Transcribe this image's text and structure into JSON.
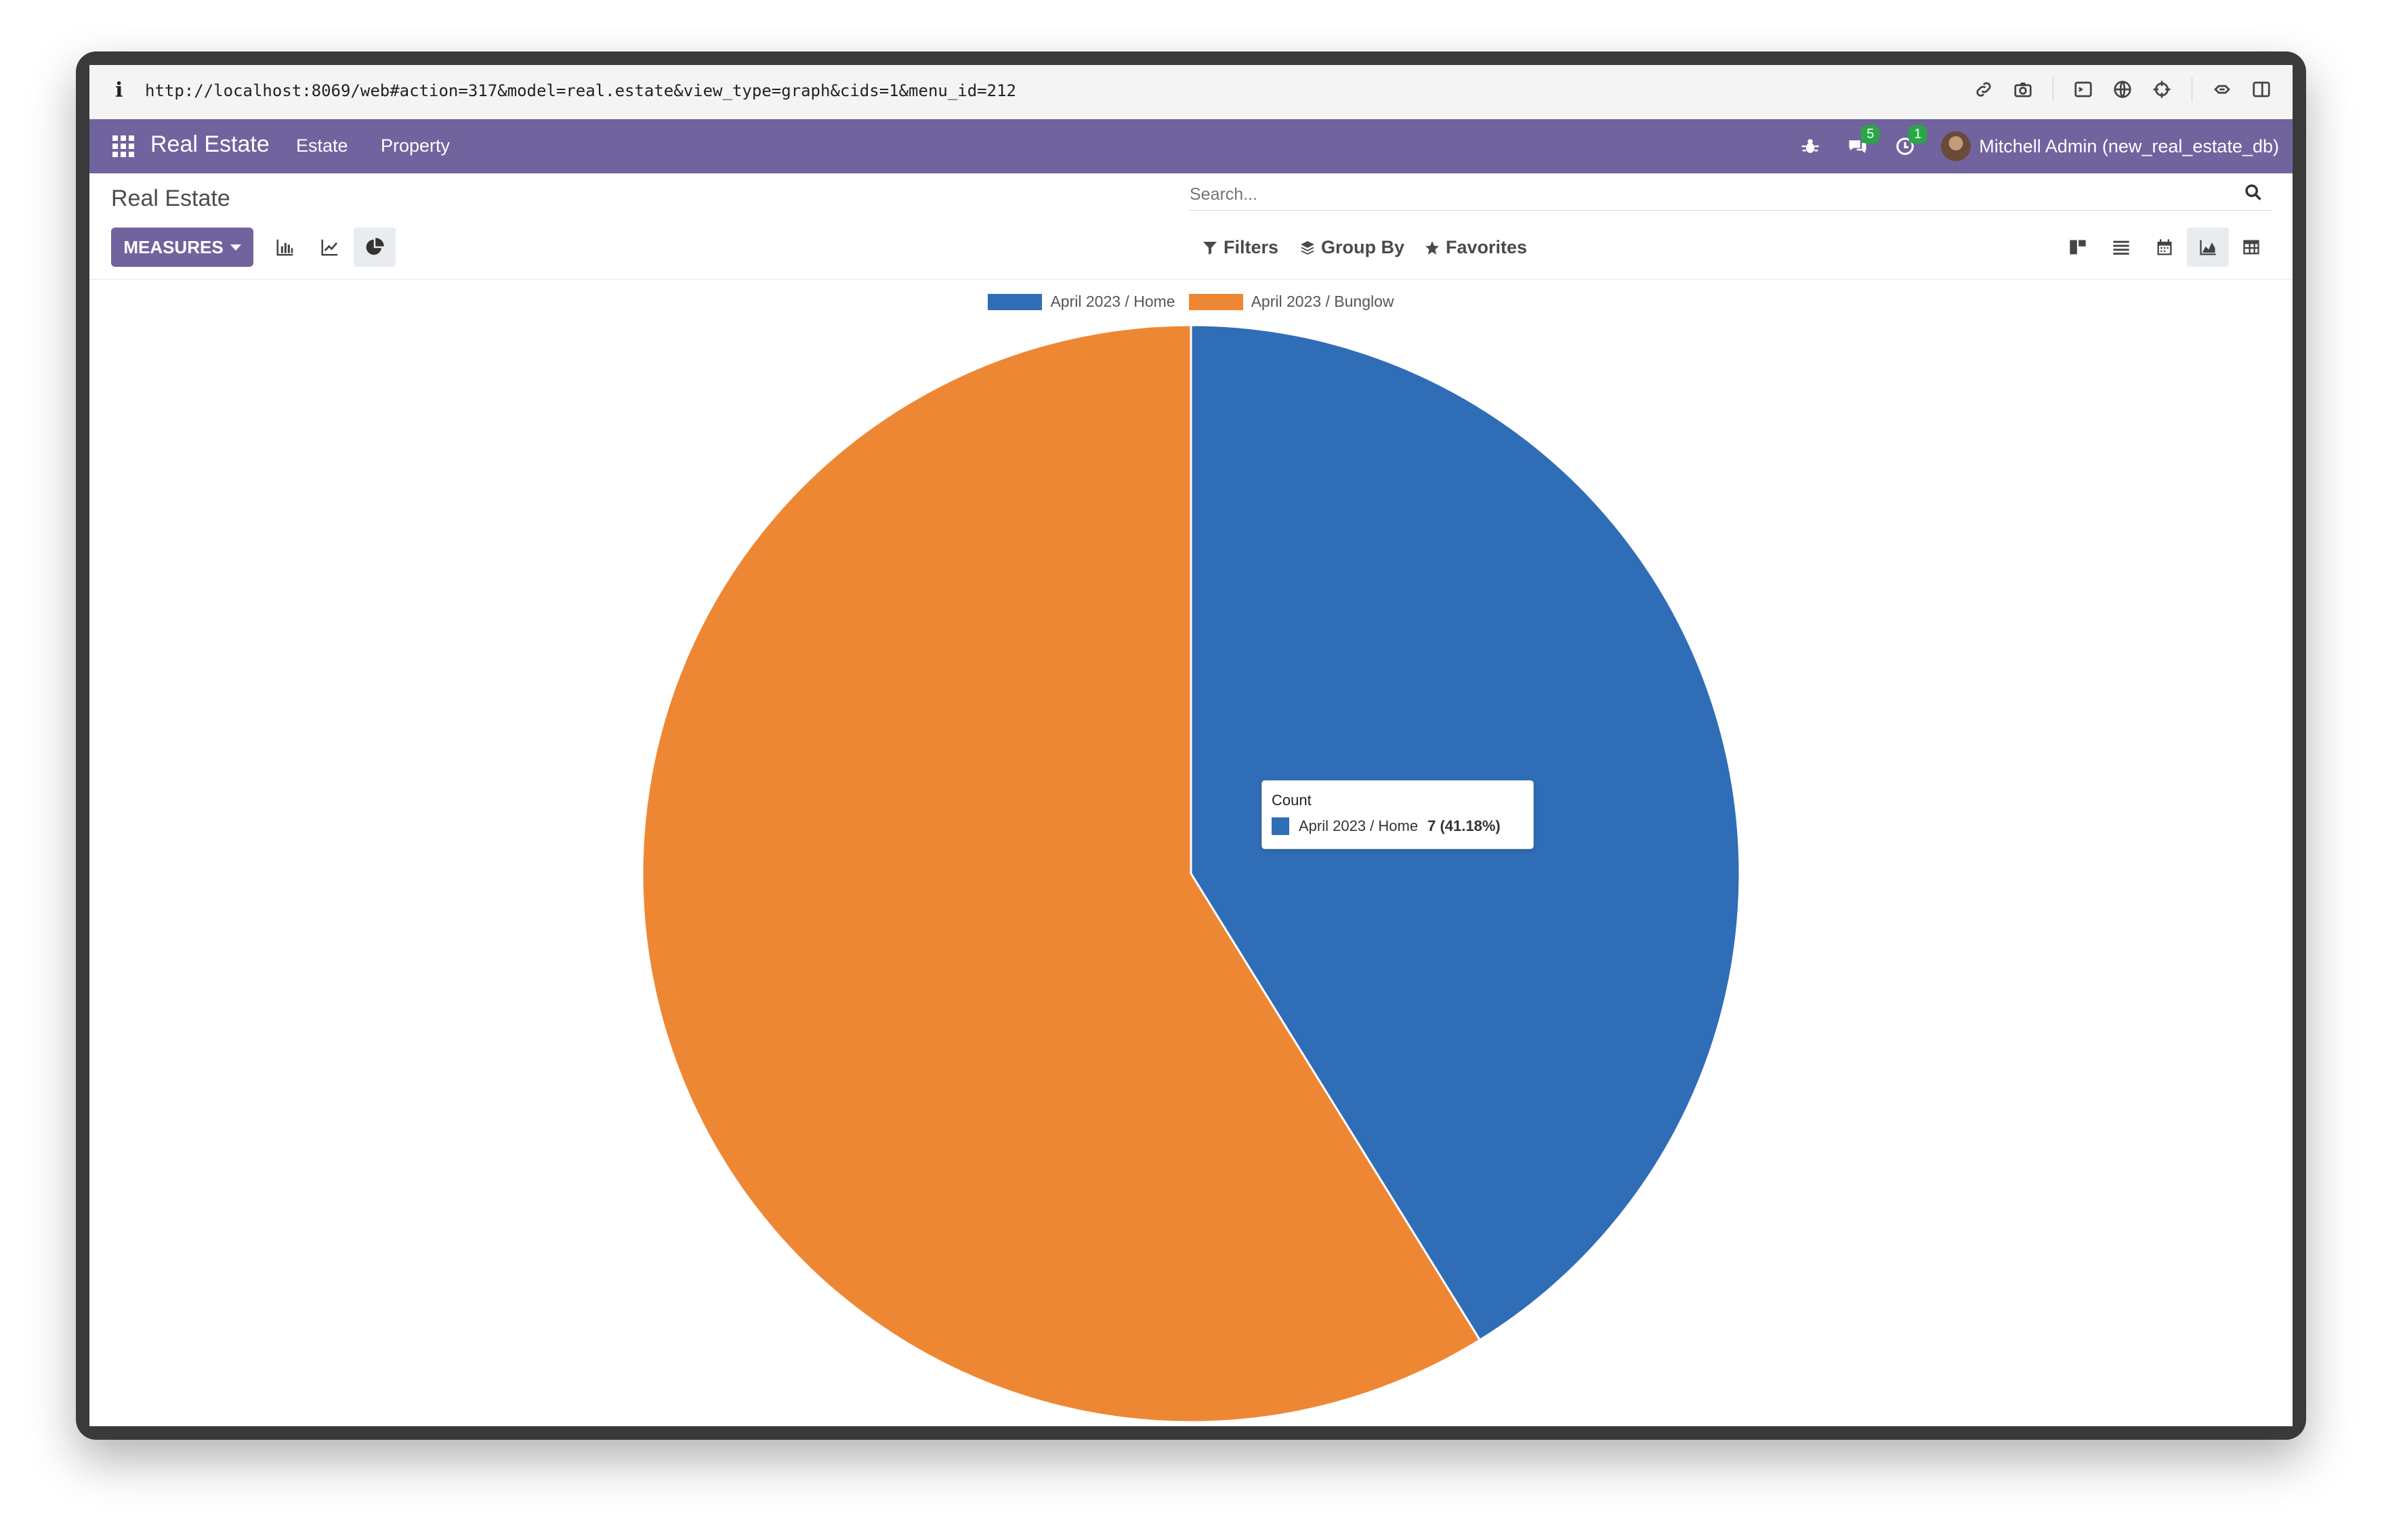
{
  "browser": {
    "info_glyph": "i",
    "url": "http://localhost:8069/web#action=317&model=real.estate&view_type=graph&cids=1&menu_id=212"
  },
  "navbar": {
    "brand": "Real Estate",
    "menu": [
      "Estate",
      "Property"
    ],
    "messages_badge": "5",
    "activities_badge": "1",
    "user": "Mitchell Admin (new_real_estate_db)"
  },
  "control_panel": {
    "title": "Real Estate",
    "search_placeholder": "Search...",
    "measures_label": "MEASURES",
    "filters_label": "Filters",
    "group_by_label": "Group By",
    "favorites_label": "Favorites"
  },
  "colors": {
    "brand": "#71639e",
    "home": "#2f6db7",
    "bunglow": "#ee8734"
  },
  "chart_data": {
    "type": "pie",
    "measure": "Count",
    "categories": [
      "April 2023 / Home",
      "April 2023 / Bunglow"
    ],
    "values": [
      7,
      10
    ],
    "colors": [
      "#2f6db7",
      "#ee8734"
    ],
    "legend_position": "top-center",
    "tooltip": {
      "title": "Count",
      "label": "April 2023 / Home",
      "value_text": "7 (41.18%)"
    }
  }
}
